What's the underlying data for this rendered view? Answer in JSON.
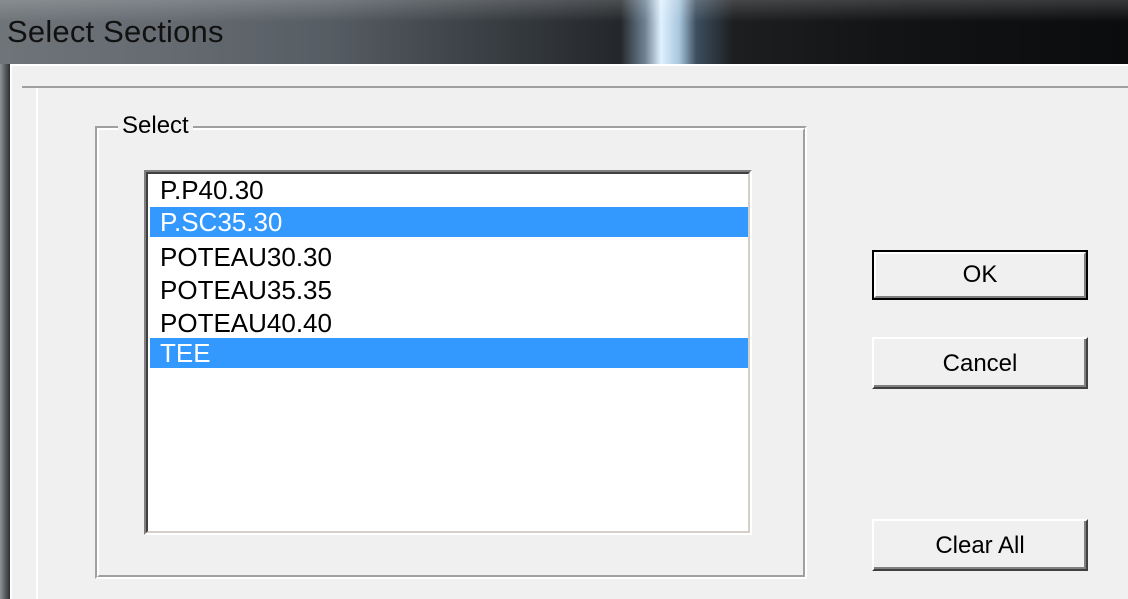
{
  "window": {
    "title": "Select Sections"
  },
  "group": {
    "label": "Select"
  },
  "list": {
    "items": [
      {
        "label": "P.P40.30",
        "selected": false
      },
      {
        "label": "P.SC35.30",
        "selected": true
      },
      {
        "label": "POTEAU30.30",
        "selected": false
      },
      {
        "label": "POTEAU35.35",
        "selected": false
      },
      {
        "label": "POTEAU40.40",
        "selected": false
      },
      {
        "label": "TEE",
        "selected": true
      }
    ]
  },
  "buttons": {
    "ok": "OK",
    "cancel": "Cancel",
    "clear_all": "Clear All"
  },
  "colors": {
    "selection": "#3399ff",
    "dialog_background": "#f0f0f0"
  }
}
